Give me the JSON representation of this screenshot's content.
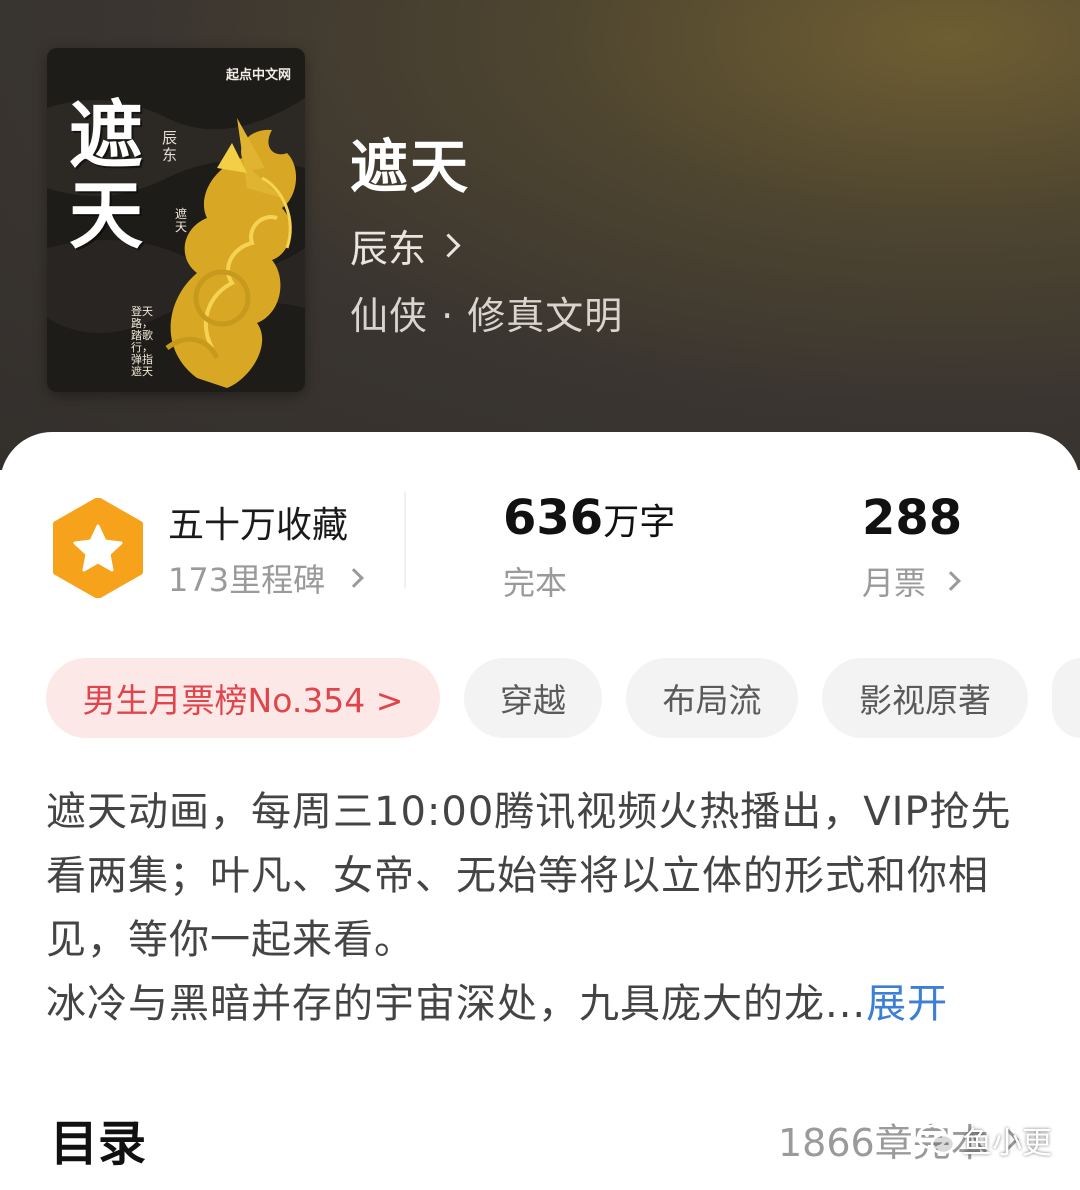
{
  "header": {
    "cover": {
      "publisher": "起点中文网",
      "title": "遮天",
      "author": "辰东",
      "small_title": "遮天",
      "slogan": "登天路，踏歌行，弹指遮天"
    },
    "title": "遮天",
    "author": "辰东",
    "genre": "仙侠 · 修真文明"
  },
  "stats": {
    "collect_title": "五十万收藏",
    "collect_sub": "173里程碑",
    "words_num": "636",
    "words_unit": "万字",
    "words_sub": "完本",
    "ticket_num": "288",
    "ticket_sub": "月票"
  },
  "tags": [
    "男生月票榜No.354 >",
    "穿越",
    "布局流",
    "影视原著"
  ],
  "description": {
    "line1": "遮天动画，每周三10:00腾讯视频火热播出，VIP抢先看两集；叶凡、女帝、无始等将以立体的形式和你相见，等你一起来看。",
    "line2": "冰冷与黑暗并存的宇宙深处，九具庞大的龙...",
    "expand": "展开"
  },
  "toc": {
    "title": "目录",
    "info": "1866章完本"
  },
  "watermark": "鱼小更",
  "colors": {
    "accent_blue": "#3d7fd6",
    "rank_red": "#e0454b",
    "badge_orange": "#f7a21b"
  }
}
